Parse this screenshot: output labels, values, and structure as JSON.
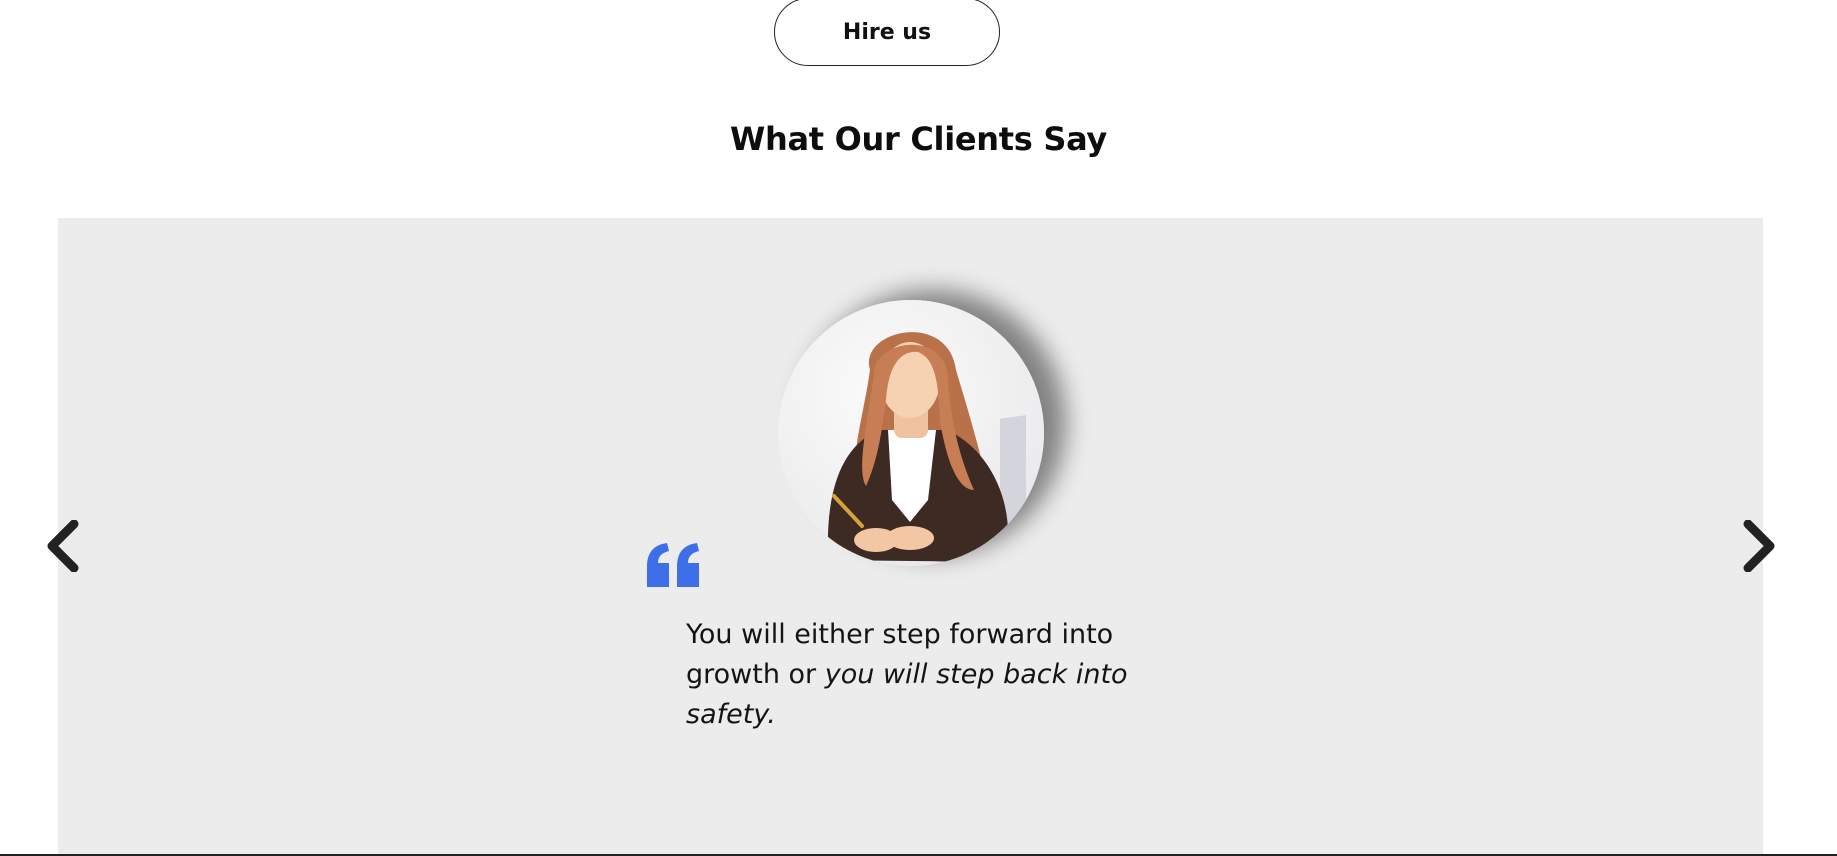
{
  "header": {
    "hire_label": "Hire us"
  },
  "testimonials": {
    "title": "What Our Clients Say",
    "icons": {
      "prev": "chevron-left-icon",
      "next": "chevron-right-icon",
      "quote": "quote-icon"
    },
    "current": {
      "text_plain": "You will either step forward into growth or",
      "text_italic": "you will step back into safety."
    },
    "colors": {
      "panel_bg": "#ececec",
      "quote_accent": "#3d6fe8",
      "arrow": "#222222"
    }
  }
}
